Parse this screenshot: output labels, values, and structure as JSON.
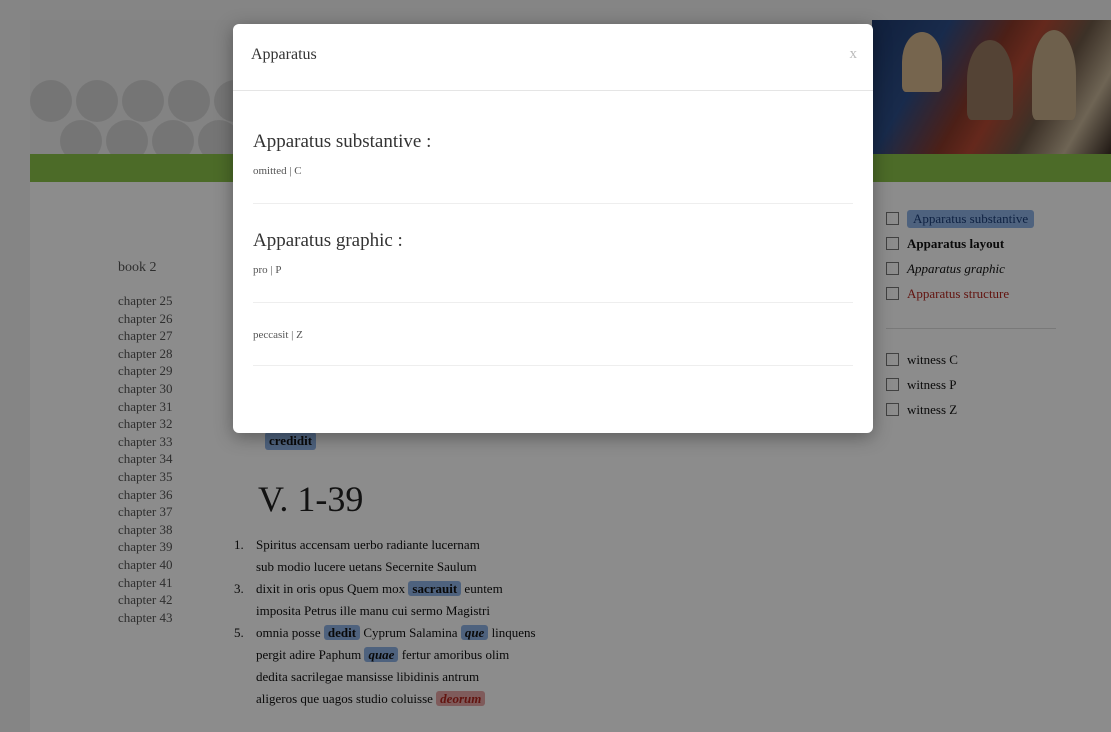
{
  "modal": {
    "title": "Apparatus",
    "close_label": "x",
    "sections": [
      {
        "heading": "Apparatus substantive :",
        "entries": [
          "omitted | C"
        ]
      },
      {
        "heading": "Apparatus graphic :",
        "entries": [
          "pro | P",
          "peccasit | Z"
        ]
      }
    ]
  },
  "toc": {
    "book": "book 2",
    "chapters": [
      "chapter 25",
      "chapter 26",
      "chapter 27",
      "chapter 28",
      "chapter 29",
      "chapter 30",
      "chapter 31",
      "chapter 32",
      "chapter 33",
      "chapter 34",
      "chapter 35",
      "chapter 36",
      "chapter 37",
      "chapter 38",
      "chapter 39",
      "chapter 40",
      "chapter 41",
      "chapter 42",
      "chapter 43"
    ]
  },
  "options": {
    "apparatus": [
      {
        "label": "Apparatus substantive",
        "style": "active"
      },
      {
        "label": "Apparatus layout",
        "style": "bold"
      },
      {
        "label": "Apparatus graphic",
        "style": "italic"
      },
      {
        "label": "Apparatus structure",
        "style": "red"
      }
    ],
    "witnesses": [
      {
        "label": "witness C"
      },
      {
        "label": "witness P"
      },
      {
        "label": "witness Z"
      }
    ]
  },
  "text": {
    "prev_highlight": "credidit",
    "verse_heading": "V. 1-39",
    "lines": [
      {
        "num": "1.",
        "parts": [
          {
            "t": "Spiritus accensam uerbo radiante lucernam"
          }
        ]
      },
      {
        "num": "",
        "parts": [
          {
            "t": "sub modio lucere uetans Secernite Saulum"
          }
        ]
      },
      {
        "num": "3.",
        "parts": [
          {
            "t": "dixit in oris opus Quem mox "
          },
          {
            "t": "sacrauit",
            "hl": "blue"
          },
          {
            "t": " euntem"
          }
        ]
      },
      {
        "num": "",
        "parts": [
          {
            "t": "imposita Petrus ille manu cui sermo Magistri"
          }
        ]
      },
      {
        "num": "5.",
        "parts": [
          {
            "t": "omnia posse "
          },
          {
            "t": "dedit",
            "hl": "blue"
          },
          {
            "t": " Cyprum Salamina "
          },
          {
            "t": "que",
            "hl": "blue-it"
          },
          {
            "t": " linquens"
          }
        ]
      },
      {
        "num": "",
        "parts": [
          {
            "t": "pergit adire Paphum "
          },
          {
            "t": "quae",
            "hl": "blue-it"
          },
          {
            "t": " fertur amoribus olim"
          }
        ]
      },
      {
        "num": "",
        "parts": [
          {
            "t": "dedita sacrilegae mansisse libidinis antrum"
          }
        ]
      },
      {
        "num": "",
        "parts": [
          {
            "t": "aligeros que uagos studio coluisse "
          },
          {
            "t": "deorum",
            "hl": "red"
          }
        ]
      }
    ]
  }
}
